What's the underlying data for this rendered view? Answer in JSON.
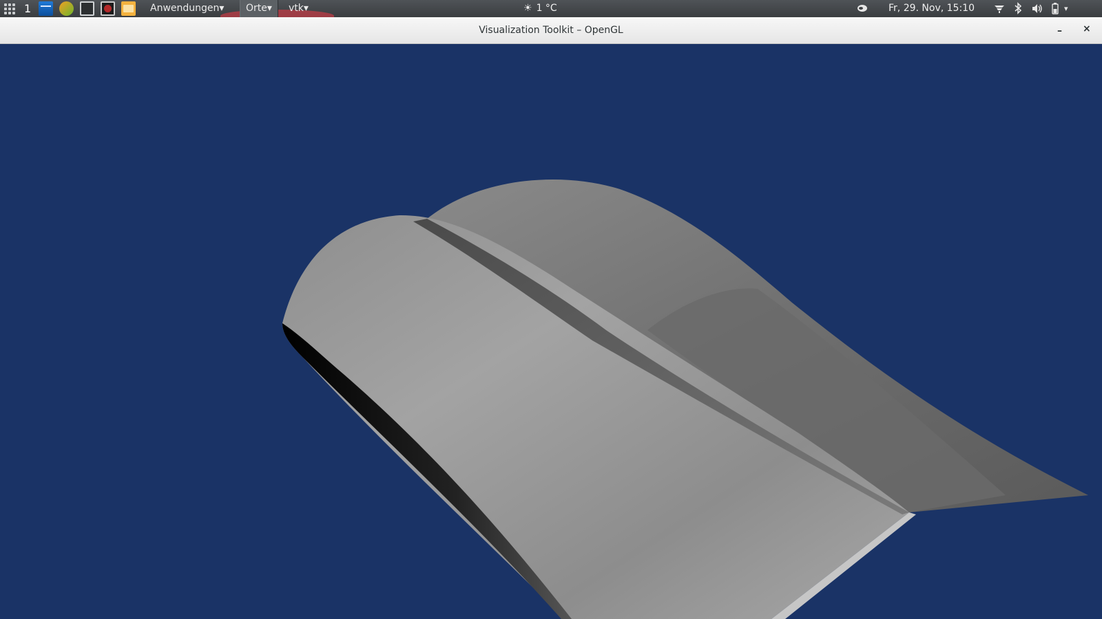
{
  "top_panel": {
    "workspace_number": "1",
    "menus": {
      "applications": "Anwendungen",
      "places": "Orte",
      "app": "vtk"
    },
    "dropdown_arrow": "▾",
    "weather": {
      "icon": "sun-cloud-icon",
      "temperature": "1 °C"
    },
    "clock": "Fr, 29. Nov, 15:10",
    "tray_icons": [
      "chat-icon",
      "network-icon",
      "bluetooth-icon",
      "volume-icon",
      "battery-icon"
    ],
    "launchers": [
      "activities-icon",
      "terminal-icon",
      "chrome-icon",
      "screenshot-icon",
      "recorder-icon",
      "files-icon"
    ]
  },
  "window": {
    "title": "Visualization Toolkit – OpenGL",
    "minimize_label": "–",
    "close_label": "×"
  },
  "scene": {
    "background_color": "#1a3366",
    "surface_color": "#a0a0a0",
    "object": "grey shaded 3D curved surface"
  }
}
